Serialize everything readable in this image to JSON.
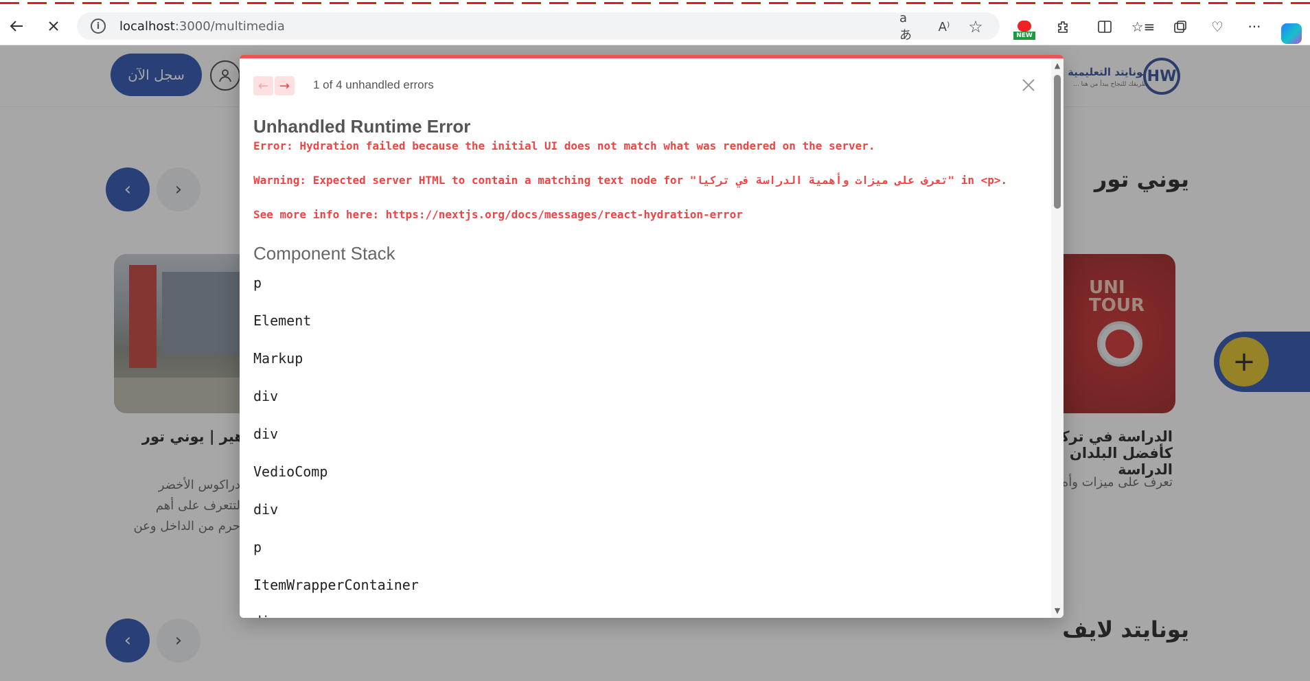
{
  "browser": {
    "url_host": "localhost",
    "url_path": ":3000/multimedia",
    "new_badge": "NEW"
  },
  "header": {
    "register_label": "سجل الآن",
    "logo_text": "يونايتد التعليمية",
    "logo_sub": "طريقك للنجاح يبدأ من هنا ...",
    "logo_mark": "HW"
  },
  "sections": [
    {
      "title": "يوني تور"
    },
    {
      "title": "يونايتد لايف"
    }
  ],
  "cards": {
    "left": {
      "title": "هير | يوني تور",
      "desc": [
        "دراكوس الأخضر",
        "لتتعرف على أهم",
        "حرم من الداخل وعن"
      ]
    },
    "right": {
      "image_text": "UNI TOUR",
      "title": [
        "الدراسة في تركيا",
        "كأفضل البلدان لا",
        "الدراسة"
      ],
      "desc": "تعرف على ميزات وأه"
    }
  },
  "error_dialog": {
    "count": "1 of 4 unhandled errors",
    "title": "Unhandled Runtime Error",
    "error_line": "Error: Hydration failed because the initial UI does not match what was rendered on the server.",
    "warning_line": "Warning: Expected server HTML to contain a matching text node for \"تعرف على ميزات وأهمية الدراسة في تركيا\" in <p>.",
    "info_line": "See more info here: https://nextjs.org/docs/messages/react-hydration-error",
    "stack_title": "Component Stack",
    "stack": [
      "p",
      "Element",
      "Markup",
      "div",
      "div",
      "VedioComp",
      "div",
      "p",
      "ItemWrapperContainer",
      "div"
    ]
  },
  "colors": {
    "accent": "#1843a8",
    "error": "#ef4444",
    "fab": "#e2be17"
  }
}
